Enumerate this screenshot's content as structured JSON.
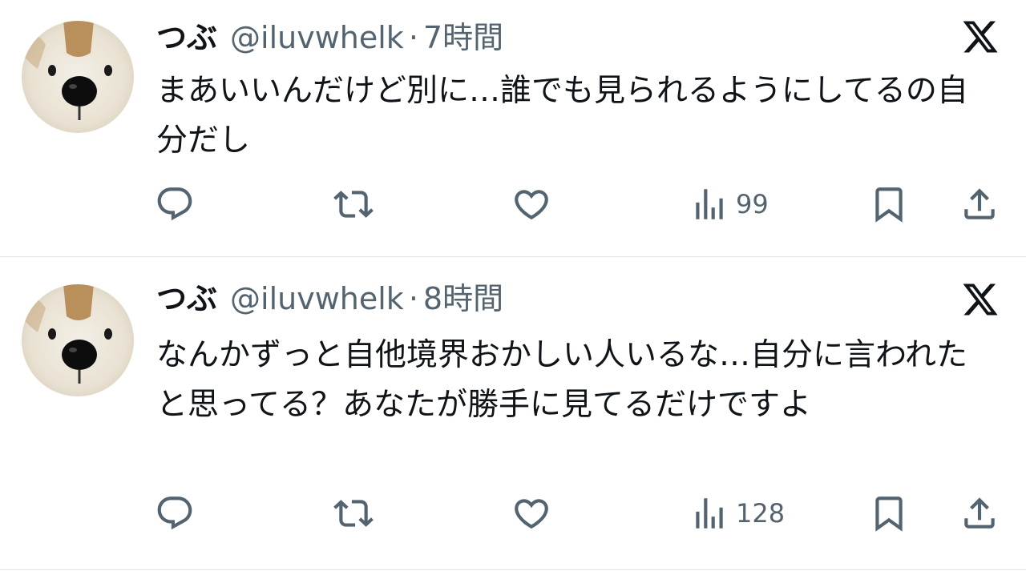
{
  "colors": {
    "text": "#0f1419",
    "secondary": "#536471",
    "divider": "#e1e4e8"
  },
  "tweets": [
    {
      "display_name": "つぶ",
      "handle": "@iluvwhelk",
      "separator": "·",
      "time": "7時間",
      "text": "まあいいんだけど別に…誰でも見られるようにしてるの自分だし",
      "views": "99"
    },
    {
      "display_name": "つぶ",
      "handle": "@iluvwhelk",
      "separator": "·",
      "time": "8時間",
      "text": "なんかずっと自他境界おかしい人いるな…自分に言われたと思ってる？あなたが勝手に見てるだけですよ",
      "views": "128"
    }
  ],
  "icons": {
    "avatar": "teddy-bear-avatar",
    "logo": "x-logo-icon",
    "reply": "reply-icon",
    "retweet": "retweet-icon",
    "like": "heart-icon",
    "views": "views-chart-icon",
    "bookmark": "bookmark-icon",
    "share": "share-icon"
  }
}
